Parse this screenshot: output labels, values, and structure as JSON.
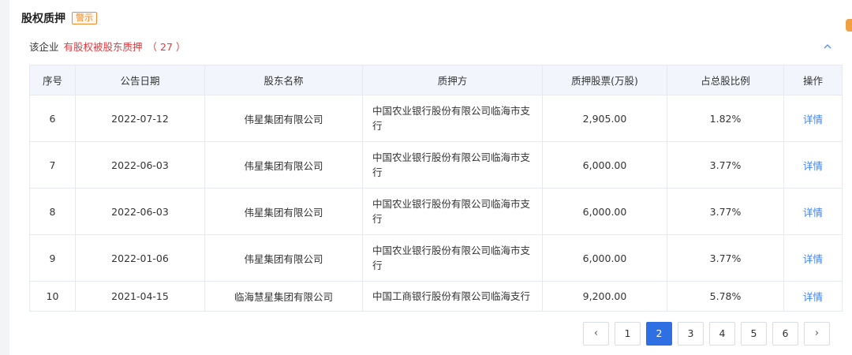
{
  "section": {
    "title": "股权质押",
    "warn_tag": "警示",
    "summary_prefix": "该企业",
    "summary_highlight": "有股权被股东质押",
    "summary_count": "（ 27 ）"
  },
  "table": {
    "headers": [
      "序号",
      "公告日期",
      "股东名称",
      "质押方",
      "质押股票(万股)",
      "占总股比例",
      "操作"
    ],
    "rows": [
      {
        "no": "6",
        "date": "2022-07-12",
        "holder": "伟星集团有限公司",
        "pledgee": "中国农业银行股份有限公司临海市支行",
        "shares": "2,905.00",
        "ratio": "1.82%",
        "action": "详情"
      },
      {
        "no": "7",
        "date": "2022-06-03",
        "holder": "伟星集团有限公司",
        "pledgee": "中国农业银行股份有限公司临海市支行",
        "shares": "6,000.00",
        "ratio": "3.77%",
        "action": "详情"
      },
      {
        "no": "8",
        "date": "2022-06-03",
        "holder": "伟星集团有限公司",
        "pledgee": "中国农业银行股份有限公司临海市支行",
        "shares": "6,000.00",
        "ratio": "3.77%",
        "action": "详情"
      },
      {
        "no": "9",
        "date": "2022-01-06",
        "holder": "伟星集团有限公司",
        "pledgee": "中国农业银行股份有限公司临海市支行",
        "shares": "6,000.00",
        "ratio": "3.77%",
        "action": "详情"
      },
      {
        "no": "10",
        "date": "2021-04-15",
        "holder": "临海慧星集团有限公司",
        "pledgee": "中国工商银行股份有限公司临海支行",
        "shares": "9,200.00",
        "ratio": "5.78%",
        "action": "详情"
      }
    ]
  },
  "pagination": {
    "prev": "‹",
    "pages": [
      "1",
      "2",
      "3",
      "4",
      "5",
      "6"
    ],
    "current": "2",
    "next": "›"
  },
  "icons": {
    "collapse": "chevron-up-icon"
  },
  "colors": {
    "accent_red": "#e4393c",
    "warn_orange": "#f08a2c",
    "link_blue": "#3b82f6",
    "active_page": "#2f6fe4"
  }
}
